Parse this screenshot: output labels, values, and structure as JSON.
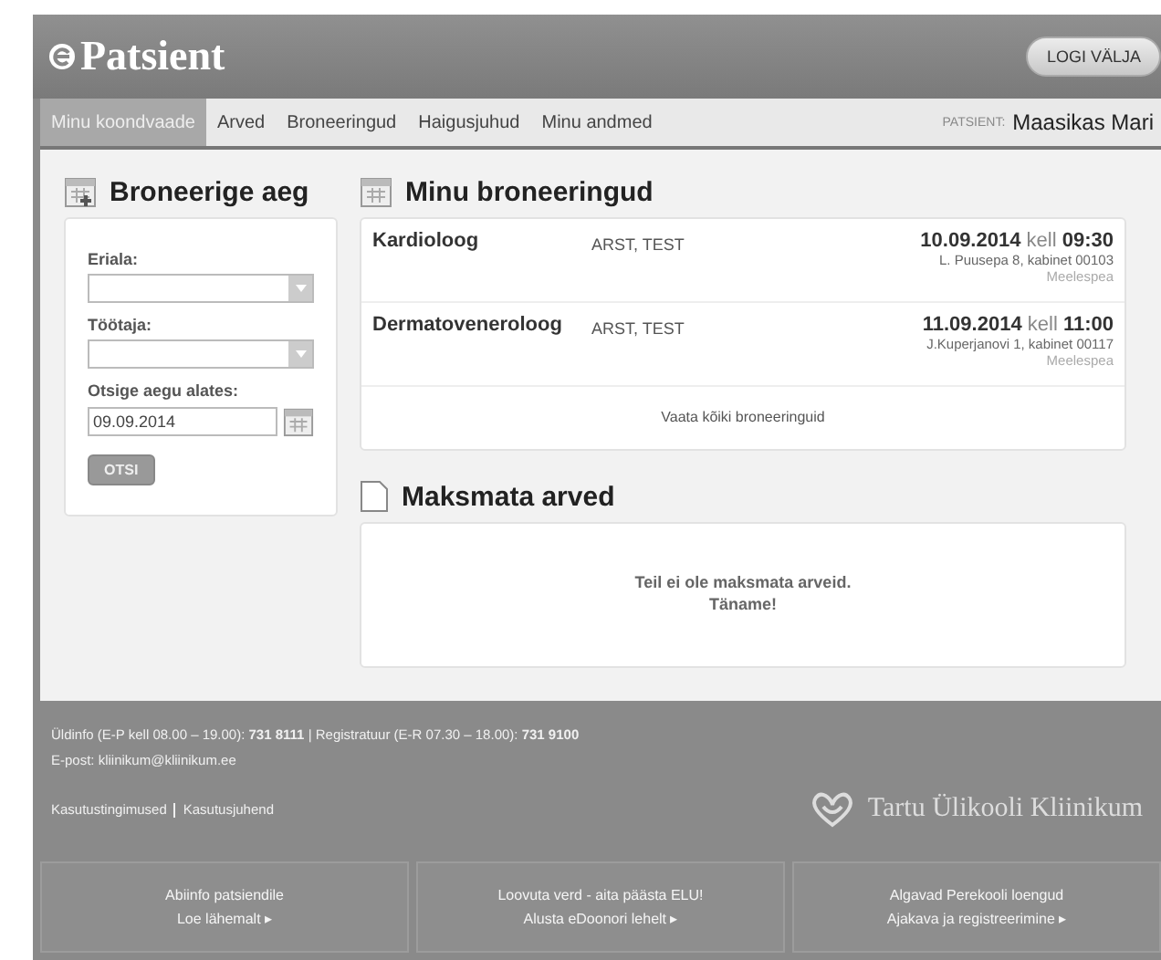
{
  "header": {
    "logo": "Patsient",
    "logout": "LOGI VÄLJA"
  },
  "nav": {
    "tabs": [
      {
        "label": "Minu koondvaade",
        "selected": true
      },
      {
        "label": "Arved",
        "selected": false
      },
      {
        "label": "Broneeringud",
        "selected": false
      },
      {
        "label": "Haigusjuhud",
        "selected": false
      },
      {
        "label": "Minu andmed",
        "selected": false
      }
    ],
    "patient_label": "PATSIENT:",
    "patient_name": "Maasikas Mari"
  },
  "booking_form": {
    "title": "Broneerige aeg",
    "fields": [
      {
        "kind": "select",
        "label": "Eriala:"
      },
      {
        "kind": "select",
        "label": "Töötaja:"
      },
      {
        "kind": "date",
        "label": "Otsige aegu alates:",
        "value": "09.09.2014"
      }
    ],
    "button": "OTSI"
  },
  "appointments": {
    "title": "Minu broneeringud",
    "rows": [
      {
        "specialty": "Kardioloog",
        "doctor": "ARST, TEST",
        "date": "10.09.2014",
        "kell": "kell",
        "time": "09:30",
        "location": "L. Puusepa 8, kabinet 00103",
        "reminder": "Meelespea"
      },
      {
        "specialty": "Dermatoveneroloog",
        "doctor": "ARST, TEST",
        "date": "11.09.2014",
        "kell": "kell",
        "time": "11:00",
        "location": "J.Kuperjanovi 1, kabinet 00117",
        "reminder": "Meelespea"
      }
    ],
    "view_all": "Vaata kõiki broneeringuid"
  },
  "invoices": {
    "title": "Maksmata arved",
    "message": [
      "Teil ei ole maksmata arveid.",
      "Täname!"
    ]
  },
  "footer": {
    "info": "Üldinfo (E-P kell 08.00 – 19.00): **731 8111**  |  Registratuur (E-R 07.30 – 18.00): **731 9100**",
    "email": "E-post: kliinikum@kliinikum.ee",
    "links": [
      "Kasutustingimused",
      "Kasutusjuhend"
    ],
    "brand": "Tartu Ülikooli Kliinikum"
  },
  "promos": [
    {
      "title": "Abiinfo patsiendile",
      "link": "Loe lähemalt ▸"
    },
    {
      "title": "Loovuta verd - aita päästa ELU!",
      "link": "Alusta eDoonori lehelt ▸"
    },
    {
      "title": "Algavad Perekooli loengud",
      "link": "Ajakava ja registreerimine ▸"
    }
  ]
}
